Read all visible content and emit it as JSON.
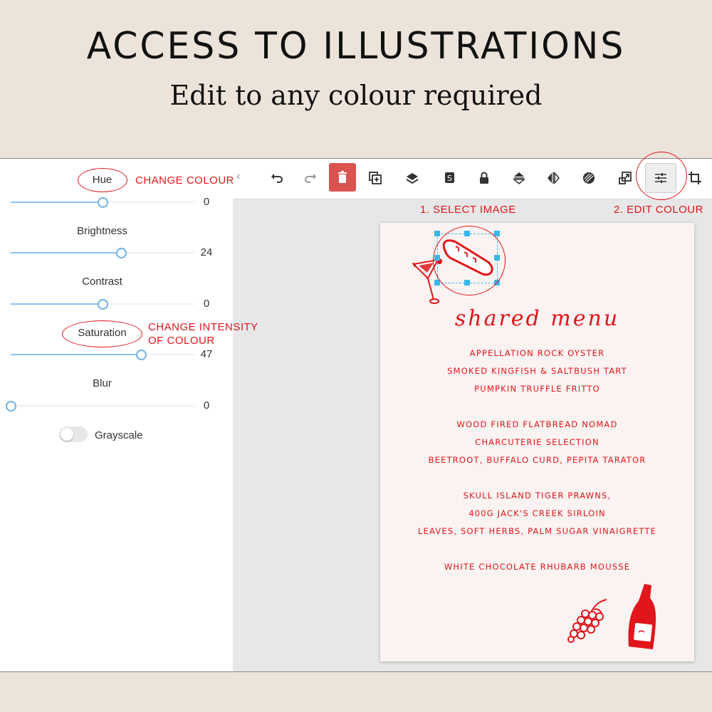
{
  "header": {
    "title": "ACCESS TO ILLUSTRATIONS",
    "subtitle": "Edit to any colour required"
  },
  "adjust_panel": {
    "controls": [
      {
        "label": "Hue",
        "value": "0",
        "level": 0.5
      },
      {
        "label": "Brightness",
        "value": "24",
        "level": 0.6
      },
      {
        "label": "Contrast",
        "value": "0",
        "level": 0.5
      },
      {
        "label": "Saturation",
        "value": "47",
        "level": 0.71
      },
      {
        "label": "Blur",
        "value": "0",
        "level": 0.0
      }
    ],
    "grayscale_label": "Grayscale",
    "grayscale_on": false
  },
  "annotations": {
    "change_colour": "CHANGE COLOUR",
    "change_intensity_line1": "CHANGE INTENSITY",
    "change_intensity_line2": "OF COLOUR",
    "select_image": "1. SELECT IMAGE",
    "edit_colour": "2. EDIT COLOUR",
    "color": "#e0161c"
  },
  "toolbar": {
    "icons": [
      "chevron-left-icon",
      "undo-icon",
      "redo-icon",
      "trash-icon",
      "duplicate-icon",
      "layer-icon",
      "style-icon",
      "lock-icon",
      "flip-vertical-icon",
      "flip-horizontal-icon",
      "transparency-icon",
      "resize-icon",
      "adjust-icon",
      "crop-icon"
    ],
    "delete_color": "#d9534f"
  },
  "menu": {
    "heading": "shared menu",
    "items": [
      "APPELLATION ROCK OYSTER",
      "SMOKED KINGFISH & SALTBUSH TART",
      "PUMPKIN TRUFFLE FRITTO",
      "WOOD FIRED FLATBREAD NOMAD",
      "CHARCUTERIE SELECTION",
      "BEETROOT, BUFFALO CURD, PEPITA TARATOR",
      "SKULL ISLAND TIGER PRAWNS,",
      "400G JACK'S CREEK SIRLOIN",
      "LEAVES, SOFT HERBS, PALM SUGAR VINAIGRETTE",
      "WHITE CHOCOLATE RHUBARB MOUSSE"
    ],
    "illustration_color": "#e0161c",
    "selection_color": "#36b8ea"
  }
}
